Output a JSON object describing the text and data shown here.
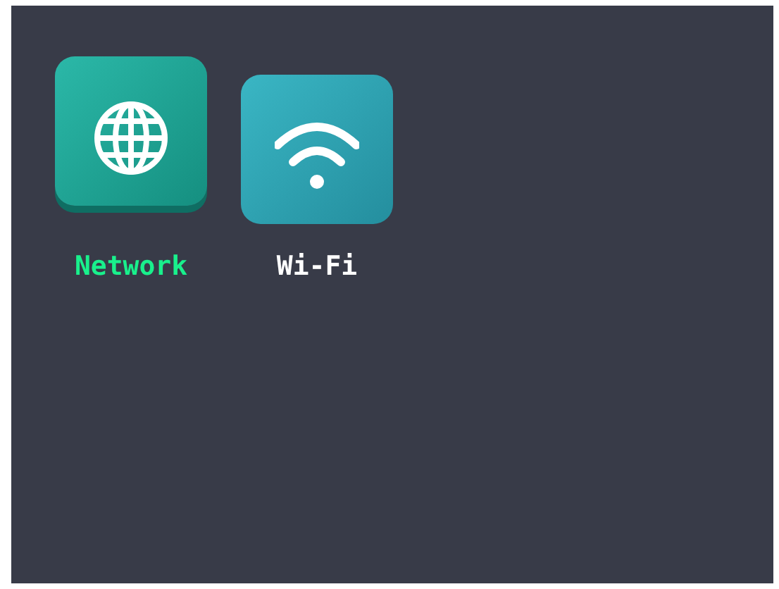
{
  "menu_items": [
    {
      "kind": "network",
      "label": "Network",
      "selected": true
    },
    {
      "kind": "wifi",
      "label": "Wi-Fi",
      "selected": false
    }
  ]
}
